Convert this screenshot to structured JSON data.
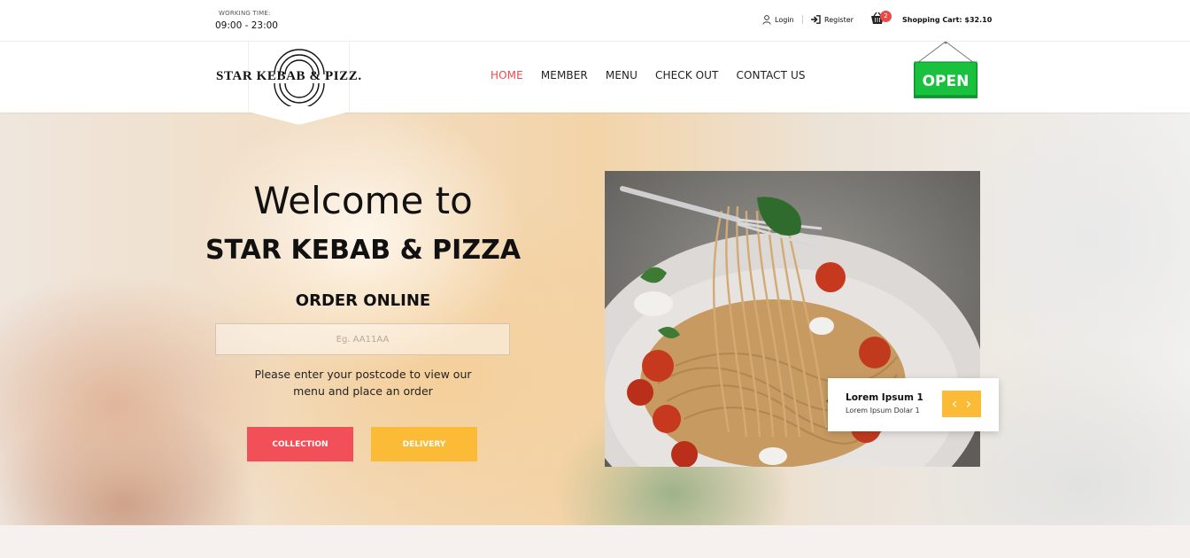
{
  "topbar": {
    "working_time_label": "WORKING TIME:",
    "working_time_value": "09:00 - 23:00",
    "login_label": "Login",
    "register_label": "Register",
    "cart_count": "2",
    "cart_label": "Shopping Cart:",
    "cart_amount": "$32.10"
  },
  "brand": {
    "logo_text": "STAR KEBAB & PIZZ."
  },
  "nav": {
    "items": [
      {
        "label": "HOME",
        "active": true
      },
      {
        "label": "MEMBER",
        "active": false
      },
      {
        "label": "MENU",
        "active": false
      },
      {
        "label": "CHECK OUT",
        "active": false
      },
      {
        "label": "CONTACT US",
        "active": false
      }
    ],
    "open_sign": "OPEN"
  },
  "hero": {
    "welcome": "Welcome to",
    "name": "STAR KEBAB & PIZZA",
    "order_heading": "ORDER ONLINE",
    "postcode_placeholder": "Eg. AA11AA",
    "help_text": "Please enter your postcode to view our menu and place an order",
    "collection_button": "COLLECTION",
    "delivery_button": "DELIVERY"
  },
  "slider": {
    "title": "Lorem Ipsum 1",
    "subtitle": "Lorem Ipsum Dolar 1",
    "prev_icon": "chevron-left-icon",
    "next_icon": "chevron-right-icon"
  },
  "colors": {
    "accent_red": "#f25058",
    "accent_yellow": "#fbbb36",
    "open_green": "#19c13f"
  }
}
